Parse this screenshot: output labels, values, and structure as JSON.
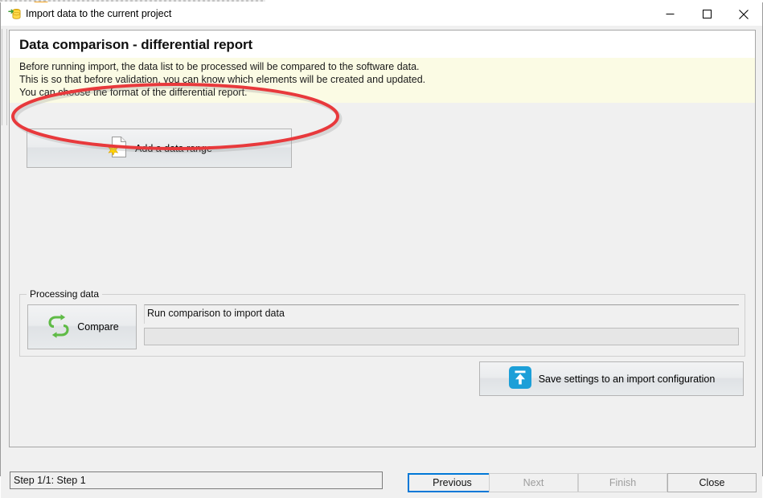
{
  "window": {
    "title": "Import data to the current project",
    "icon": "database-import-icon",
    "controls": {
      "minimize": "minimize-icon",
      "maximize": "maximize-icon",
      "close": "close-icon"
    }
  },
  "banner": {
    "title": "Data comparison - differential report",
    "description_lines": [
      "Before running import, the data list to be processed will be compared to the software data.",
      "This is so that before validation, you can know which elements will be created and updated.",
      "You can choose the format of the differential report."
    ]
  },
  "actions": {
    "add_data_range": "Add a data range",
    "add_data_range_icon": "new-document-star-icon",
    "save_settings": "Save settings to an import configuration",
    "save_settings_icon": "upload-save-icon"
  },
  "processing": {
    "group_caption": "Processing data",
    "compare_label": "Compare",
    "compare_icon": "refresh-sync-icon",
    "status_text": "Run comparison to import data",
    "progress_percent": 0
  },
  "footer": {
    "step_status": "Step 1/1: Step 1",
    "buttons": [
      {
        "label": "Previous",
        "state": "focused"
      },
      {
        "label": "Next",
        "state": "disabled"
      },
      {
        "label": "Finish",
        "state": "disabled"
      },
      {
        "label": "Close",
        "state": "enabled"
      }
    ]
  },
  "annotation": {
    "shape": "ellipse",
    "color": "#e8393c"
  },
  "colors": {
    "banner_note_bg": "#fbfbe4",
    "window_bg": "#f0f0f0",
    "accent_focus": "#0078d7",
    "icon_green": "#5fbb46",
    "icon_blue": "#1c9fd8",
    "icon_yellow": "#ffd400"
  }
}
